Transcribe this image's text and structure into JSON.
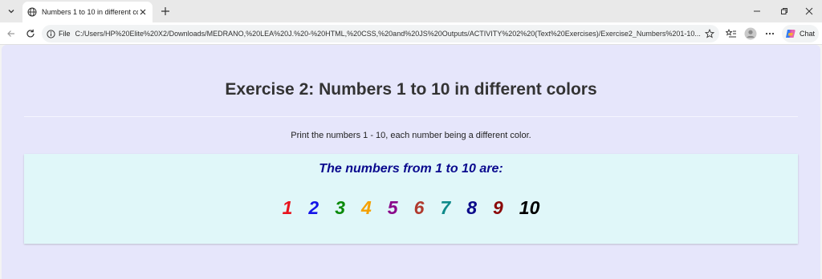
{
  "browser": {
    "tab_title": "Numbers 1 to 10 in different colors",
    "file_label": "File",
    "url": "C:/Users/HP%20Elite%20X2/Downloads/MEDRANO,%20LEA%20J.%20-%20HTML,%20CSS,%20and%20JS%20Outputs/ACTIVITY%202%20(Text%20Exercises)/Exercise2_Numbers%201-10...",
    "chat_label": "Chat"
  },
  "page": {
    "title": "Exercise 2: Numbers 1 to 10 in different colors",
    "description": "Print the numbers 1 - 10, each number being a different color.",
    "box_heading": "The numbers from 1 to 10 are:",
    "numbers": [
      {
        "label": "1",
        "color": "#e8141e"
      },
      {
        "label": "2",
        "color": "#1414e8"
      },
      {
        "label": "3",
        "color": "#0a8a0a"
      },
      {
        "label": "4",
        "color": "#f5a000"
      },
      {
        "label": "5",
        "color": "#8a0a8a"
      },
      {
        "label": "6",
        "color": "#b03a2e"
      },
      {
        "label": "7",
        "color": "#0f8a8a"
      },
      {
        "label": "8",
        "color": "#0a0a8a"
      },
      {
        "label": "9",
        "color": "#8a0a0a"
      },
      {
        "label": "10",
        "color": "#000000"
      }
    ]
  }
}
